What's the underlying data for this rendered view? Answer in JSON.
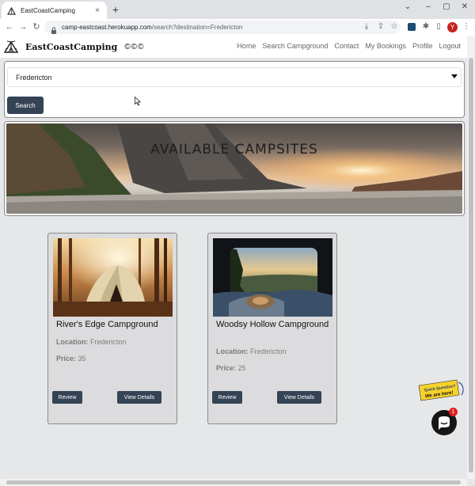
{
  "browser": {
    "tab_title": "EastCoastCamping",
    "tab_close": "×",
    "new_tab": "+",
    "url_host": "camp-eastcoast.herokuapp.com",
    "url_path": "/search?destination=Fredericton",
    "profile_initial": "Y",
    "window_controls": {
      "chevron": "⌄",
      "minimize": "–",
      "maximize": "▢",
      "close": "✕"
    },
    "nav": {
      "back": "←",
      "forward": "→",
      "reload": "↻"
    },
    "toolbar_icons": {
      "install": "⤓",
      "share": "⇪",
      "star": "☆",
      "extensions": "✱",
      "sidebar": "▯",
      "menu": "⋮"
    }
  },
  "site": {
    "brand": "EastCoastCamping",
    "brand_symbols": "©©©",
    "nav": [
      "Home",
      "Search Campground",
      "Contact",
      "My Bookings",
      "Profile",
      "Logout"
    ]
  },
  "search": {
    "selected_destination": "Fredericton",
    "button_label": "Search"
  },
  "hero": {
    "title": "AVAILABLE CAMPSITES"
  },
  "campgrounds": [
    {
      "name": "River's Edge Campground",
      "location_label": "Location:",
      "location": "Fredericton",
      "price_label": "Price:",
      "price": "35",
      "review_label": "Review",
      "details_label": "View Details"
    },
    {
      "name": "Woodsy Hollow Campground",
      "location_label": "Location:",
      "location": "Fredericton",
      "price_label": "Price:",
      "price": "25",
      "review_label": "Review",
      "details_label": "View Details"
    }
  ],
  "chat": {
    "quick_question_line1": "Quick Question?",
    "quick_question_line2": "We are here!",
    "badge_count": "1"
  },
  "colors": {
    "primary_button": "#344356",
    "card_bg": "#dcdcde",
    "page_bg": "#e6e7e9",
    "chat_badge": "#e0211f"
  },
  "icons": [
    "tent-logo-icon",
    "lock-icon",
    "caret-down-icon",
    "chat-icon",
    "mouse-cursor-icon"
  ]
}
